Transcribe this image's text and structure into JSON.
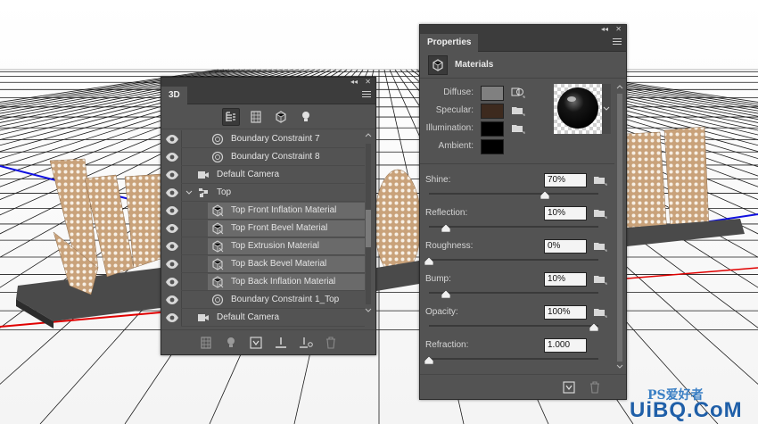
{
  "panel_3d": {
    "tab": "3D",
    "topbar_collapse": "◂◂",
    "topbar_close": "✕",
    "filter_tools": [
      {
        "name": "scene-filter-icon",
        "active": true
      },
      {
        "name": "mesh-filter-icon",
        "active": false
      },
      {
        "name": "material-filter-icon",
        "active": false
      },
      {
        "name": "light-filter-icon",
        "active": false
      }
    ],
    "layers": [
      {
        "label": "Boundary Constraint 7",
        "icon": "constraint",
        "indent": 2,
        "visible": true,
        "selected": false
      },
      {
        "label": "Boundary Constraint 8",
        "icon": "constraint",
        "indent": 2,
        "visible": true,
        "selected": false
      },
      {
        "label": "Default Camera",
        "icon": "camera",
        "indent": 1,
        "visible": true,
        "selected": false
      },
      {
        "label": "Top",
        "icon": "mesh",
        "indent": 1,
        "visible": true,
        "selected": false,
        "expanded": true
      },
      {
        "label": "Top Front Inflation Material",
        "icon": "material",
        "indent": 2,
        "visible": true,
        "selected": true
      },
      {
        "label": "Top Front Bevel Material",
        "icon": "material",
        "indent": 2,
        "visible": true,
        "selected": true
      },
      {
        "label": "Top Extrusion Material",
        "icon": "material",
        "indent": 2,
        "visible": true,
        "selected": true
      },
      {
        "label": "Top Back Bevel Material",
        "icon": "material",
        "indent": 2,
        "visible": true,
        "selected": true
      },
      {
        "label": "Top Back Inflation Material",
        "icon": "material",
        "indent": 2,
        "visible": true,
        "selected": true
      },
      {
        "label": "Boundary Constraint 1_Top",
        "icon": "constraint",
        "indent": 2,
        "visible": true,
        "selected": false
      },
      {
        "label": "Default Camera",
        "icon": "camera",
        "indent": 1,
        "visible": true,
        "selected": false
      }
    ]
  },
  "panel_properties": {
    "tab": "Properties",
    "topbar_collapse": "◂◂",
    "topbar_close": "✕",
    "section_title": "Materials",
    "materials": [
      {
        "label": "Diffuse:",
        "color": "#808080"
      },
      {
        "label": "Specular:",
        "color": "#3d2a1e"
      },
      {
        "label": "Illumination:",
        "color": "#000000"
      },
      {
        "label": "Ambient:",
        "color": "#000000"
      }
    ],
    "properties": [
      {
        "label": "Shine:",
        "value": "70%",
        "fraction": 0.7
      },
      {
        "label": "Reflection:",
        "value": "10%",
        "fraction": 0.1
      },
      {
        "label": "Roughness:",
        "value": "0%",
        "fraction": 0.0
      },
      {
        "label": "Bump:",
        "value": "10%",
        "fraction": 0.1
      },
      {
        "label": "Opacity:",
        "value": "100%",
        "fraction": 1.0
      },
      {
        "label": "Refraction:",
        "value": "1.000",
        "fraction": 0.0
      }
    ]
  },
  "watermark": {
    "line1": "PS爱好者",
    "line2": "UiBQ.CoM"
  }
}
